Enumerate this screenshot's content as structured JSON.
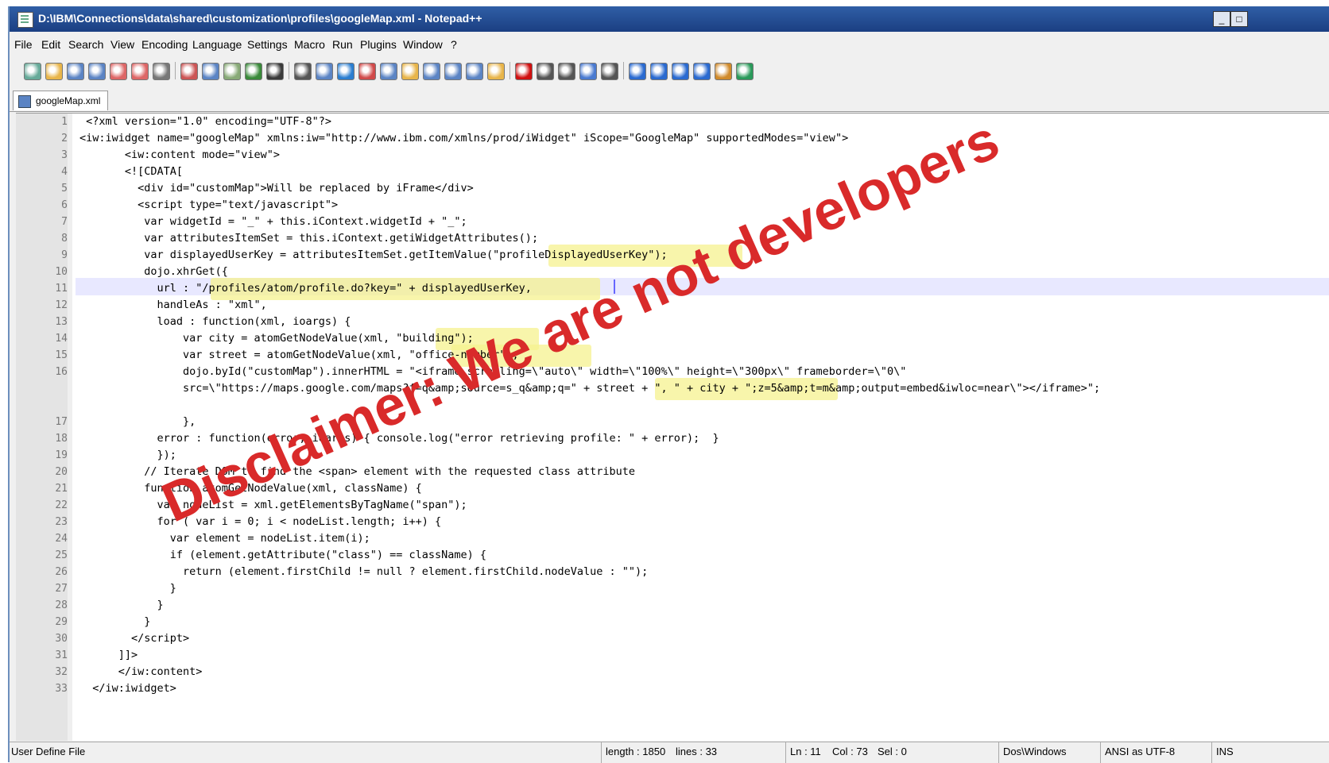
{
  "window": {
    "title": "D:\\IBM\\Connections\\data\\shared\\customization\\profiles\\googleMap.xml - Notepad++"
  },
  "menu": [
    "File",
    "Edit",
    "Search",
    "View",
    "Encoding",
    "Language",
    "Settings",
    "Macro",
    "Run",
    "Plugins",
    "Window",
    "?"
  ],
  "toolbar": {
    "icons": [
      "new-file-icon",
      "open-file-icon",
      "save-icon",
      "save-all-icon",
      "close-icon",
      "close-all-icon",
      "print-icon",
      "cut-icon",
      "copy-icon",
      "paste-icon",
      "undo-icon",
      "redo-icon",
      "find-icon",
      "replace-icon",
      "zoom-in-icon",
      "zoom-out-icon",
      "sync-vertical-icon",
      "sync-horizontal-icon",
      "word-wrap-icon",
      "show-all-chars-icon",
      "indent-guide-icon",
      "doc-map-icon",
      "record-macro-icon",
      "stop-macro-icon",
      "play-macro-icon",
      "run-macro-multiple-icon",
      "save-macro-icon",
      "fold-all-icon",
      "prev-icon",
      "next-icon",
      "unfold-all-icon",
      "trim-icon",
      "spell-check-icon"
    ]
  },
  "tab": {
    "label": "googleMap.xml"
  },
  "editor": {
    "line_numbers": [
      "1",
      "2",
      "3",
      "4",
      "5",
      "6",
      "7",
      "8",
      "9",
      "10",
      "11",
      "12",
      "13",
      "14",
      "15",
      "16",
      "",
      "",
      "17",
      "18",
      "19",
      "20",
      "21",
      "22",
      "23",
      "24",
      "25",
      "26",
      "27",
      "28",
      "29",
      "30",
      "31",
      "32",
      "33"
    ],
    "lines": [
      " <?xml version=\"1.0\" encoding=\"UTF-8\"?>",
      "<iw:iwidget name=\"googleMap\" xmlns:iw=\"http://www.ibm.com/xmlns/prod/iWidget\" iScope=\"GoogleMap\" supportedModes=\"view\">",
      "       <iw:content mode=\"view\">",
      "       <![CDATA[",
      "         <div id=\"customMap\">Will be replaced by iFrame</div>",
      "         <script type=\"text/javascript\">",
      "          var widgetId = \"_\" + this.iContext.widgetId + \"_\";",
      "          var attributesItemSet = this.iContext.getiWidgetAttributes();",
      "          var displayedUserKey = attributesItemSet.getItemValue(\"profileDisplayedUserKey\");",
      "          dojo.xhrGet({",
      "            url : \"/profiles/atom/profile.do?key=\" + displayedUserKey,",
      "            handleAs : \"xml\",",
      "            load : function(xml, ioargs) {",
      "                var city = atomGetNodeValue(xml, \"building\");",
      "                var street = atomGetNodeValue(xml, \"office-number\");",
      "                dojo.byId(\"customMap\").innerHTML = \"<iframe scrolling=\\\"auto\\\" width=\\\"100%\\\" height=\\\"300px\\\" frameborder=\\\"0\\\"",
      "                src=\\\"https://maps.google.com/maps?f=q&amp;source=s_q&amp;q=\" + street + \", \" + city + \";z=5&amp;t=m&amp;output=embed&iwloc=near\\\"></iframe>\";",
      "",
      "                },",
      "            error : function(error, ioargs) { console.log(\"error retrieving profile: \" + error);  }",
      "            });",
      "          // Iterate DOM to find the <span> element with the requested class attribute",
      "          function atomGetNodeValue(xml, className) {",
      "            var nodeList = xml.getElementsByTagName(\"span\");",
      "            for ( var i = 0; i < nodeList.length; i++) {",
      "              var element = nodeList.item(i);",
      "              if (element.getAttribute(\"class\") == className) {",
      "                return (element.firstChild != null ? element.firstChild.nodeValue : \"\");",
      "              }",
      "            }",
      "          }",
      "        </script>",
      "      ]]>",
      "      </iw:content>",
      "  </iw:iwidget>"
    ]
  },
  "overlay": {
    "text": "Disclaimer: We are not developers",
    "color": "#d92a2a"
  },
  "status": {
    "type": "User Define File",
    "length": "length : 1850",
    "lines": "lines : 33",
    "ln": "Ln : 11",
    "col": "Col : 73",
    "sel": "Sel : 0",
    "eol": "Dos\\Windows",
    "encoding": "ANSI as UTF-8",
    "mode": "INS"
  }
}
